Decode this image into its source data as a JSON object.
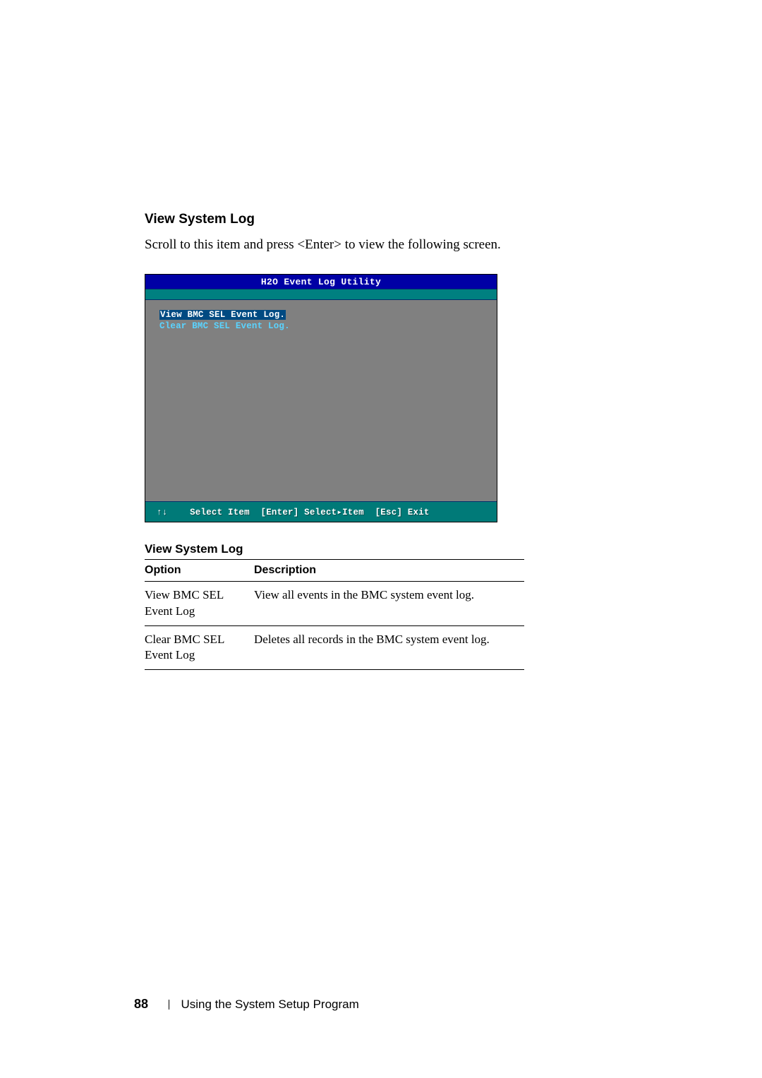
{
  "heading1": "View System Log",
  "intro": "Scroll to this item and press <Enter> to view the following screen.",
  "bios": {
    "title": "H2O Event Log Utility",
    "menu": {
      "item1": "View BMC SEL Event Log.",
      "item2": "Clear BMC SEL Event Log."
    },
    "footer": {
      "arrows": "↑↓",
      "select_item": "Select Item",
      "enter": "[Enter] Select▸Item",
      "esc": "[Esc] Exit"
    }
  },
  "table": {
    "caption": "View System Log",
    "headers": {
      "option": "Option",
      "description": "Description"
    },
    "rows": [
      {
        "option": "View BMC SEL Event Log",
        "description": "View all events in the BMC system event log."
      },
      {
        "option": "Clear BMC SEL Event Log",
        "description": "Deletes all records in the BMC system event log."
      }
    ]
  },
  "footer": {
    "page_number": "88",
    "section": "Using the System Setup Program"
  }
}
